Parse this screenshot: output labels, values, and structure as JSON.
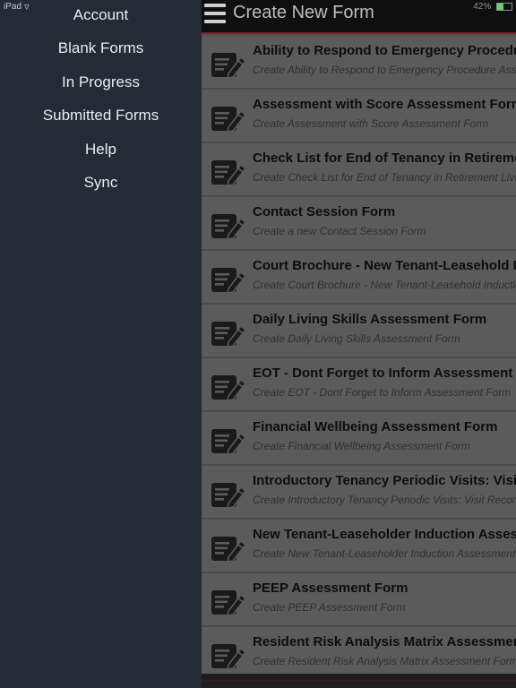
{
  "status": {
    "device": "iPad",
    "battery_percent": "42%",
    "battery_level": 0.42,
    "wifi_icon": "wifi-icon"
  },
  "menu": {
    "items": [
      {
        "label": "Account"
      },
      {
        "label": "Blank Forms"
      },
      {
        "label": "In Progress"
      },
      {
        "label": "Submitted Forms"
      },
      {
        "label": "Help"
      },
      {
        "label": "Sync"
      }
    ]
  },
  "header": {
    "title": "Create New Form",
    "menu_icon": "hamburger-menu-icon"
  },
  "forms": [
    {
      "title": "Ability to Respond to Emergency Procedures",
      "subtitle": "Create Ability to Respond to Emergency Procedure Assessment"
    },
    {
      "title": "Assessment with Score Assessment Form",
      "subtitle": "Create Assessment with Score Assessment Form"
    },
    {
      "title": "Check List for End of Tenancy in Retirement Living",
      "subtitle": "Create Check List for End of Tenancy in Retirement Living"
    },
    {
      "title": "Contact Session Form",
      "subtitle": "Create a new Contact Session Form"
    },
    {
      "title": "Court Brochure - New Tenant-Leasehold Induction",
      "subtitle": "Create Court Brochure - New Tenant-Leasehold Induction"
    },
    {
      "title": "Daily Living Skills Assessment Form",
      "subtitle": "Create Daily Living Skills Assessment Form"
    },
    {
      "title": "EOT - Dont Forget to Inform Assessment Form",
      "subtitle": "Create EOT - Dont Forget to Inform Assessment Form"
    },
    {
      "title": "Financial Wellbeing Assessment Form",
      "subtitle": "Create Financial Wellbeing Assessment Form"
    },
    {
      "title": "Introductory Tenancy Periodic Visits: Visit Record",
      "subtitle": "Create Introductory Tenancy Periodic Visits: Visit Record"
    },
    {
      "title": "New Tenant-Leaseholder Induction Assessment",
      "subtitle": "Create New Tenant-Leaseholder Induction Assessment"
    },
    {
      "title": "PEEP Assessment Form",
      "subtitle": "Create PEEP Assessment Form"
    },
    {
      "title": "Resident Risk Analysis Matrix Assessment Form",
      "subtitle": "Create Resident Risk Analysis Matrix Assessment Form"
    }
  ],
  "colors": {
    "menu_bg": "#242b35",
    "row_bg": "#5b5b5b",
    "accent_line": "#8c1b21"
  }
}
